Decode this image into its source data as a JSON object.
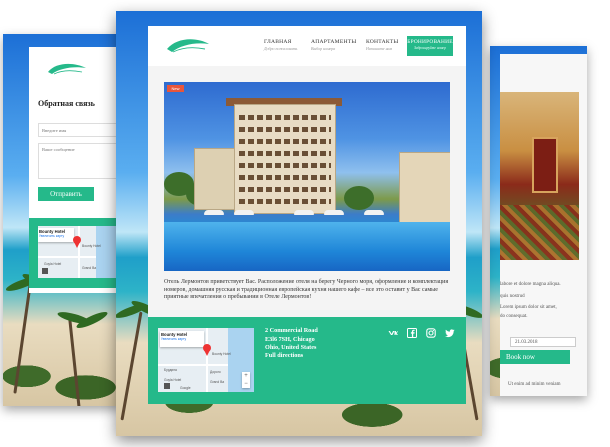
{
  "main": {
    "nav": [
      {
        "label": "ГЛАВНАЯ",
        "sub": "Добро пожаловать"
      },
      {
        "label": "АПАРТАМЕНТЫ",
        "sub": "Выбор номера"
      },
      {
        "label": "КОНТАКТЫ",
        "sub": "Напишите нам"
      }
    ],
    "book_button": {
      "label": "БРОНИРОВАНИЕ",
      "sub": "Забронируйте номер"
    },
    "badge": "New",
    "description": "Отель Лермонтов приветствует Вас. Расположение отеля на берегу Черного моря, оформление и комплектация номеров, домашняя русская и традиционная европейская кухня нашего кафе – все это оставит у Вас самые приятные впечатления о пребывании в Отеле Лермонтов!",
    "footer": {
      "address": [
        "2 Commercial Road",
        "E3l6 7SH, Chicago",
        "Ohio, United States",
        "Full directions"
      ],
      "social_icons": [
        "vk-icon",
        "facebook-icon",
        "instagram-icon",
        "twitter-icon"
      ]
    },
    "map": {
      "title": "Bounty Hotel",
      "link": "Увеличить карту",
      "pin_label": "Bounty Hotel",
      "labels": [
        "Бурдина",
        "Дорого",
        "Goyla Hotel",
        "Grand Ba",
        "Google"
      ]
    }
  },
  "left": {
    "title": "Обратная связь",
    "name_placeholder": "Введите имя",
    "message_placeholder": "Ваше сообщение",
    "send_label": "Отправить",
    "map": {
      "title": "Bounty Hotel",
      "link": "Увеличить карту",
      "pin_label": "Bounty Hotel",
      "labels": [
        "Goyla Hotel",
        "Grand Ba",
        "Google"
      ]
    }
  },
  "right": {
    "text_lines": [
      "labore et dolore magna aliqua.",
      "quis nostrud",
      "Lorem ipsum dolor sit amet,",
      "do consequat.",
      "tempor incididunt"
    ],
    "date": "21.03.2018",
    "book_label": "Book now",
    "bottom_text": "Ut enim ad minim veniam"
  },
  "colors": {
    "accent": "#25b98a",
    "badge": "#e8563c"
  }
}
